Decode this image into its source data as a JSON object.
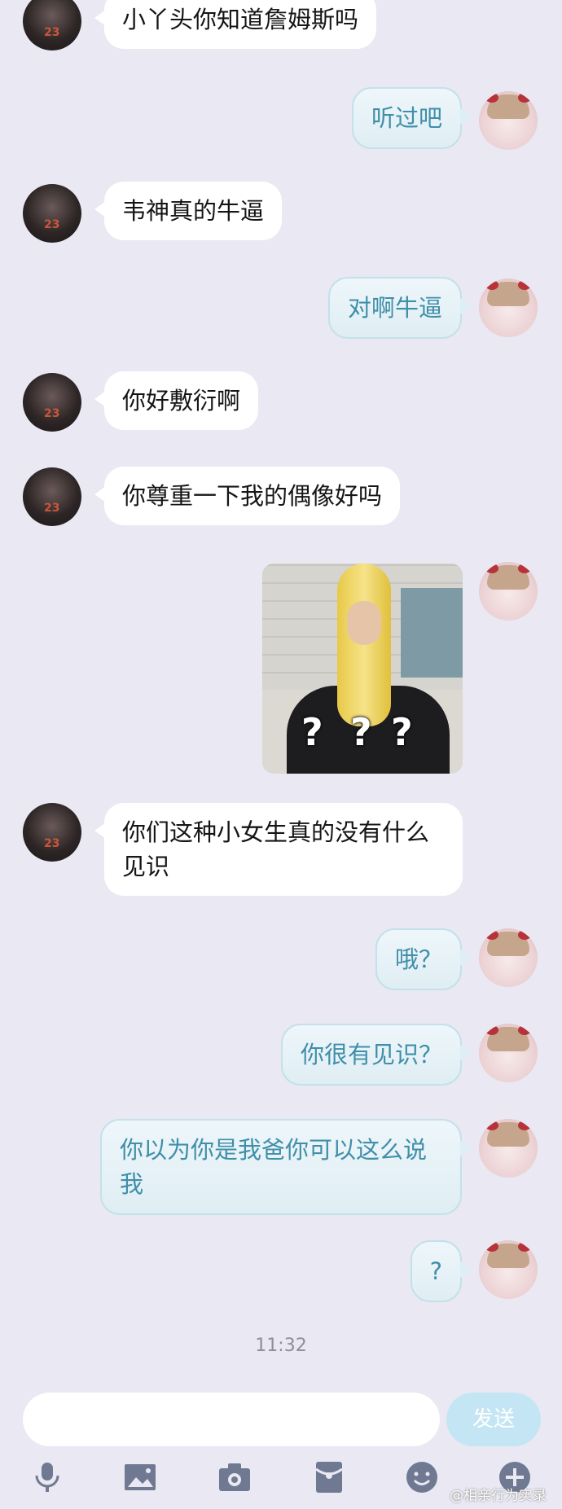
{
  "messages": [
    {
      "side": "left",
      "text": "小丫头你知道詹姆斯吗"
    },
    {
      "side": "right",
      "text": "听过吧"
    },
    {
      "side": "left",
      "text": "韦神真的牛逼"
    },
    {
      "side": "right",
      "text": "对啊牛逼"
    },
    {
      "side": "left",
      "text": "你好敷衍啊"
    },
    {
      "side": "left",
      "text": "你尊重一下我的偶像好吗"
    },
    {
      "side": "right",
      "type": "image",
      "overlay_text": [
        "?",
        "?",
        "?"
      ]
    },
    {
      "side": "left",
      "text": "你们这种小女生真的没有什么见识"
    },
    {
      "side": "right",
      "text": "哦？"
    },
    {
      "side": "right",
      "text": "你很有见识？"
    },
    {
      "side": "right",
      "text": "你以为你是我爸你可以这么说我"
    },
    {
      "side": "right",
      "text": "?"
    }
  ],
  "timestamp": "11:32",
  "input": {
    "placeholder": "",
    "send_label": "发送"
  },
  "toolbar": {
    "icons": [
      "microphone-icon",
      "image-icon",
      "camera-icon",
      "red-packet-icon",
      "emoji-icon",
      "plus-icon"
    ]
  },
  "watermark": "@相亲行为实录",
  "colors": {
    "background": "#e9e8f3",
    "left_bubble": "#ffffff",
    "right_bubble_text": "#3f8fa9",
    "send_button": "#c4e6f4"
  }
}
